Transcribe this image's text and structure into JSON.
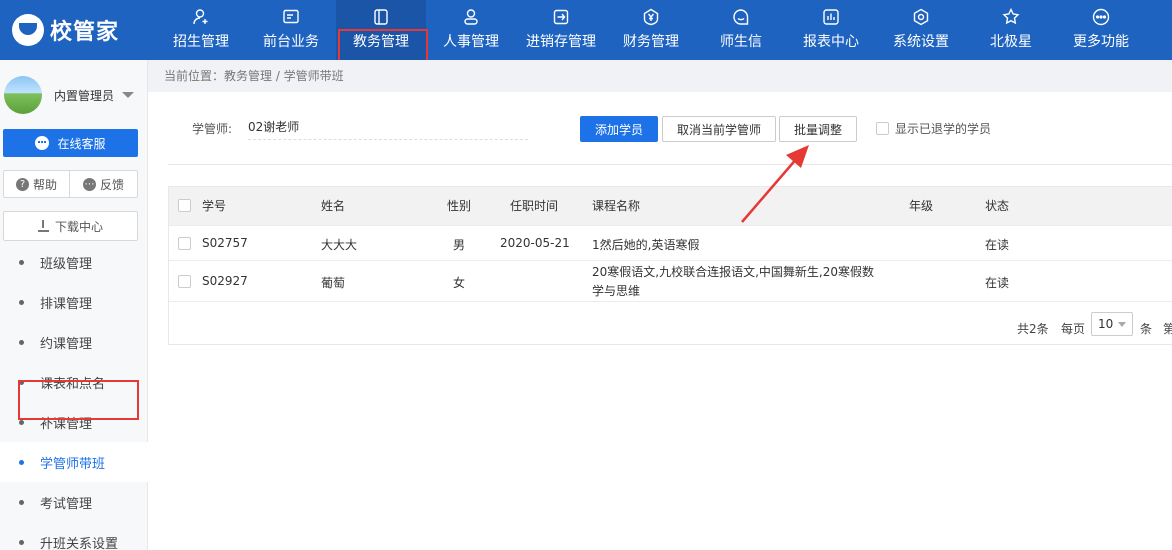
{
  "brand": {
    "name": "校管家"
  },
  "nav": [
    {
      "label": "招生管理",
      "icon": "person-add-icon"
    },
    {
      "label": "前台业务",
      "icon": "screen-icon"
    },
    {
      "label": "教务管理",
      "icon": "book-icon",
      "active": true
    },
    {
      "label": "人事管理",
      "icon": "person-icon"
    },
    {
      "label": "进销存管理",
      "icon": "arrow-box-icon"
    },
    {
      "label": "财务管理",
      "icon": "yen-shield-icon"
    },
    {
      "label": "师生信",
      "icon": "chat-icon"
    },
    {
      "label": "报表中心",
      "icon": "bar-chart-icon"
    },
    {
      "label": "系统设置",
      "icon": "gear-icon"
    },
    {
      "label": "北极星",
      "icon": "star-icon"
    },
    {
      "label": "更多功能",
      "icon": "more-icon"
    }
  ],
  "user": {
    "name": "内置管理员"
  },
  "sidebar": {
    "service_label": "在线客服",
    "help_label": "帮助",
    "help_glyph": "?",
    "feedback_label": "反馈",
    "download_label": "下载中心",
    "menu": [
      {
        "label": "班级管理"
      },
      {
        "label": "排课管理"
      },
      {
        "label": "约课管理"
      },
      {
        "label": "课表和点名"
      },
      {
        "label": "补课管理"
      },
      {
        "label": "学管师带班",
        "active": true
      },
      {
        "label": "考试管理"
      },
      {
        "label": "升班关系设置"
      }
    ]
  },
  "breadcrumb": "当前位置：教务管理 / 学管师带班",
  "filter": {
    "label": "学管师:",
    "value": "02谢老师"
  },
  "toolbar": {
    "add_label": "添加学员",
    "cancel_label": "取消当前学管师",
    "batch_label": "批量调整",
    "show_withdrawn_label": "显示已退学的学员"
  },
  "table": {
    "headers": {
      "id": "学号",
      "name": "姓名",
      "gender": "性别",
      "date": "任职时间",
      "course": "课程名称",
      "grade": "年级",
      "status": "状态"
    },
    "rows": [
      {
        "id": "S02757",
        "name": "大大大",
        "gender": "男",
        "date": "2020-05-21",
        "course": "1然后她的,英语寒假",
        "grade": "",
        "status": "在读"
      },
      {
        "id": "S02927",
        "name": "葡萄",
        "gender": "女",
        "date": "",
        "course": "20寒假语文,九校联合连报语文,中国舞新生,20寒假数学与思维",
        "grade": "",
        "status": "在读"
      }
    ]
  },
  "pager": {
    "total": "共2条",
    "per_page_label": "每页",
    "page_size": "10",
    "unit": "条",
    "jump_label": "第"
  },
  "colors": {
    "topbar": "#1f63c1",
    "primary": "#1e72e8",
    "highlight": "#e53935"
  }
}
